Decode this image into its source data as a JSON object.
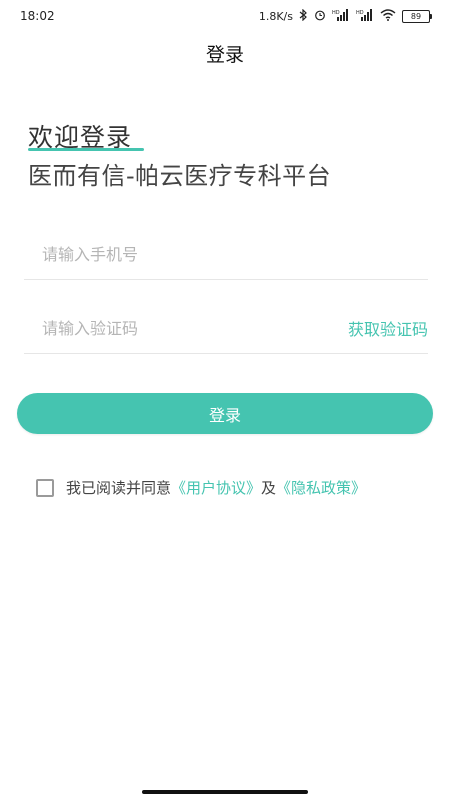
{
  "status_bar": {
    "time": "18:02",
    "net_speed": "1.8K/s",
    "battery": "89",
    "icons": [
      "bluetooth-icon",
      "alarm-icon",
      "signal-hd-icon",
      "signal-hd-icon",
      "wifi-icon"
    ]
  },
  "header": {
    "title": "登录"
  },
  "intro": {
    "welcome": "欢迎登录",
    "subtitle": "医而有信-帕云医疗专科平台"
  },
  "form": {
    "phone_placeholder": "请输入手机号",
    "code_placeholder": "请输入验证码",
    "get_code_label": "获取验证码",
    "login_label": "登录"
  },
  "agreement": {
    "prefix": "我已阅读并同意",
    "user_agreement": "《用户协议》",
    "conjunction": "及",
    "privacy_policy": "《隐私政策》",
    "checked": false
  },
  "colors": {
    "accent": "#45c4b0"
  }
}
